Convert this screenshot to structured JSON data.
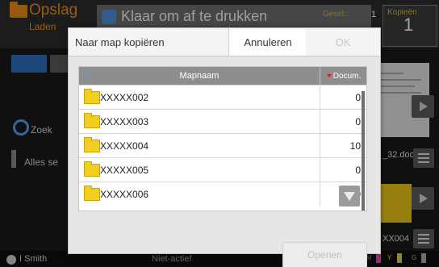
{
  "background_app": {
    "storage_title": "Opslag",
    "storage_load": "Laden",
    "status_text": "Klaar om af te drukken",
    "sets_label": "Gesel.:",
    "sets_value": "1",
    "copies_label": "Kopieën",
    "copies_value": "1",
    "search_label": "Zoek",
    "select_all_label": "Alles se",
    "file1_name": "_32.doc",
    "file2_name": "XX004",
    "user_name": "I Smith",
    "printer_status": "Niet-actief",
    "ink_labels": [
      "K",
      "C",
      "M",
      "Y",
      "G"
    ]
  },
  "dialog": {
    "title": "Naar map kopiëren",
    "cancel_label": "Annuleren",
    "ok_label": "OK",
    "open_label": "Openen",
    "table": {
      "columns": [
        "Mapnaam",
        "Docum."
      ],
      "rows": [
        {
          "name": "XXXXX002",
          "docs": "0"
        },
        {
          "name": "XXXXX003",
          "docs": "0"
        },
        {
          "name": "XXXXX004",
          "docs": "10"
        },
        {
          "name": "XXXXX005",
          "docs": "0"
        },
        {
          "name": "XXXXX006",
          "docs": "0"
        }
      ]
    }
  },
  "colors": {
    "accent_orange": "#f08c1a",
    "accent_blue": "#2f6fbf",
    "folder_yellow": "#f2cf1e",
    "header_gray": "#8e8e8e"
  }
}
